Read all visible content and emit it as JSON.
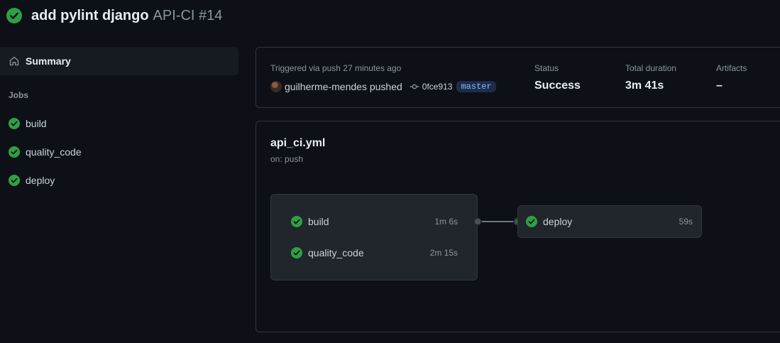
{
  "header": {
    "title": "add pylint django",
    "workflow": "API-CI #14"
  },
  "sidebar": {
    "summary_label": "Summary",
    "jobs_heading": "Jobs",
    "jobs": [
      {
        "label": "build"
      },
      {
        "label": "quality_code"
      },
      {
        "label": "deploy"
      }
    ]
  },
  "run_info": {
    "trigger_text": "Triggered via push 27 minutes ago",
    "pusher_text": "guilherme-mendes pushed",
    "commit_sha": "0fce913",
    "branch": "master",
    "status_label": "Status",
    "status_value": "Success",
    "duration_label": "Total duration",
    "duration_value": "3m 41s",
    "artifacts_label": "Artifacts",
    "artifacts_value": "–"
  },
  "graph": {
    "file": "api_ci.yml",
    "trigger": "on: push",
    "group_jobs": [
      {
        "label": "build",
        "duration": "1m 6s"
      },
      {
        "label": "quality_code",
        "duration": "2m 15s"
      }
    ],
    "next_job": {
      "label": "deploy",
      "duration": "59s"
    }
  },
  "colors": {
    "success": "#2ea043",
    "background": "#0d1117",
    "branch_text": "#79c0ff"
  },
  "icons": [
    "check-circle-icon",
    "home-icon",
    "commit-icon",
    "avatar"
  ]
}
